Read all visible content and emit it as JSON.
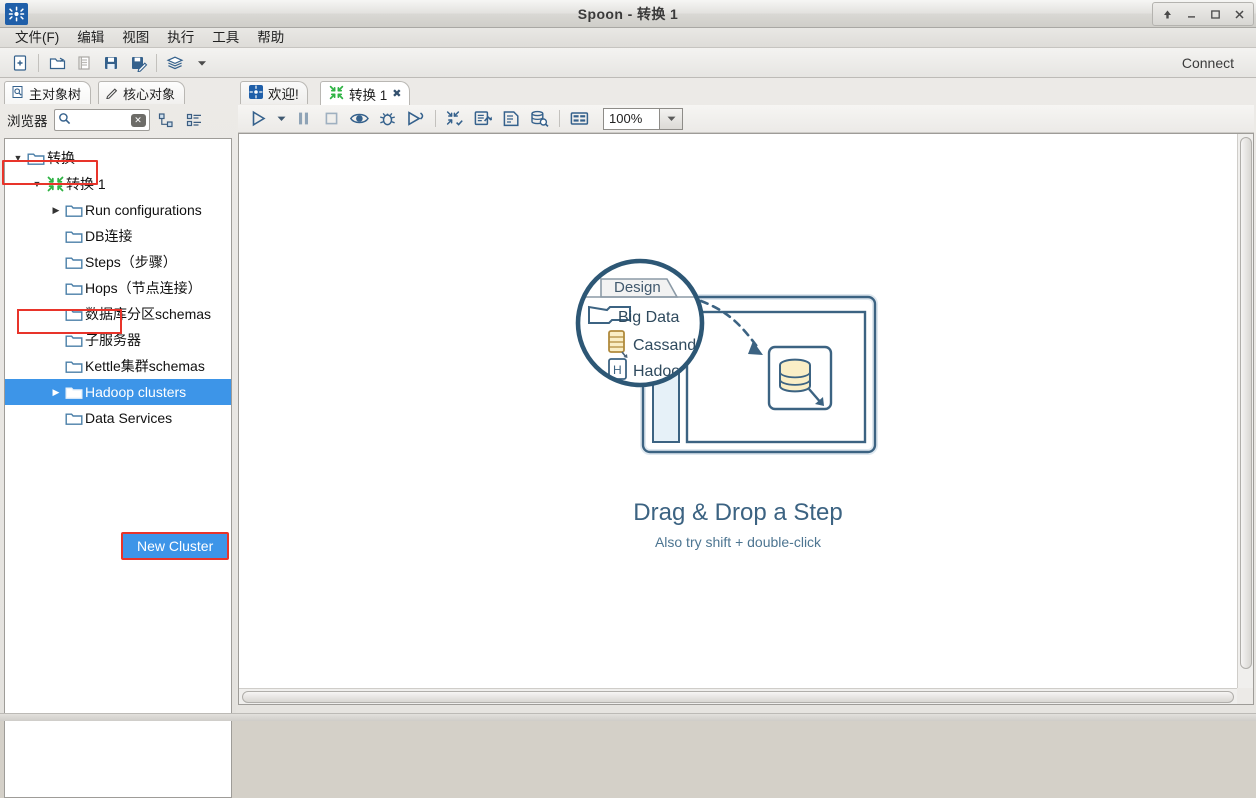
{
  "window": {
    "title": "Spoon - 转换 1",
    "logo_icon": "pentaho-spoon-logo-icon",
    "controls": [
      {
        "name": "restore-up-button",
        "glyph": "⬆"
      },
      {
        "name": "minimize-button",
        "glyph": "–"
      },
      {
        "name": "maximize-button",
        "glyph": "❐"
      },
      {
        "name": "close-button",
        "glyph": "✕"
      }
    ]
  },
  "menubar": {
    "items": [
      {
        "label": "文件(F)",
        "name": "menu-file"
      },
      {
        "label": "编辑",
        "name": "menu-edit"
      },
      {
        "label": "视图",
        "name": "menu-view"
      },
      {
        "label": "执行",
        "name": "menu-run"
      },
      {
        "label": "工具",
        "name": "menu-tools"
      },
      {
        "label": "帮助",
        "name": "menu-help"
      }
    ]
  },
  "toolbar": {
    "connect_label": "Connect",
    "buttons": [
      {
        "name": "new-file-button",
        "icon": "new-file-icon"
      },
      {
        "name": "open-file-button",
        "icon": "open-folder-icon"
      },
      {
        "name": "explorer-panel-button",
        "icon": "panel-list-icon"
      },
      {
        "name": "save-button",
        "icon": "floppy-save-icon"
      },
      {
        "name": "save-as-button",
        "icon": "save-as-pencil-icon"
      },
      {
        "name": "layers-button",
        "icon": "layers-stack-icon"
      },
      {
        "name": "layers-dropdown-button",
        "icon": "chevron-down-icon"
      }
    ]
  },
  "left_panel": {
    "tabs": [
      {
        "label": "主对象树",
        "name": "tab-main-object-tree",
        "icon": "document-search-icon",
        "active": true,
        "highlighted": true
      },
      {
        "label": "核心对象",
        "name": "tab-core-objects",
        "icon": "pencil-icon",
        "active": false,
        "highlighted": false
      }
    ],
    "browser_label": "浏览器",
    "search": {
      "value": "",
      "placeholder": "",
      "icon": "search-icon",
      "clear_icon": "clear-x-icon"
    },
    "tree_tools": [
      {
        "name": "collapse-all-button",
        "icon": "hierarchy-collapse-icon"
      },
      {
        "name": "expand-all-button",
        "icon": "list-expand-icon"
      }
    ],
    "tree": [
      {
        "label": "转换",
        "icon": "folder-icon",
        "twisty": "▼",
        "indent": 0,
        "selected": false
      },
      {
        "label": "转换 1",
        "icon": "transformation-green-icon",
        "twisty": "▼",
        "indent": 1,
        "selected": false,
        "highlighted": true
      },
      {
        "label": "Run configurations",
        "icon": "folder-icon",
        "twisty": "▶",
        "indent": 2,
        "selected": false
      },
      {
        "label": "DB连接",
        "icon": "folder-icon",
        "twisty": "",
        "indent": 2,
        "selected": false
      },
      {
        "label": "Steps（步骤）",
        "icon": "folder-icon",
        "twisty": "",
        "indent": 2,
        "selected": false
      },
      {
        "label": "Hops（节点连接）",
        "icon": "folder-icon",
        "twisty": "",
        "indent": 2,
        "selected": false
      },
      {
        "label": "数据库分区schemas",
        "icon": "folder-icon",
        "twisty": "",
        "indent": 2,
        "selected": false
      },
      {
        "label": "子服务器",
        "icon": "folder-icon",
        "twisty": "",
        "indent": 2,
        "selected": false
      },
      {
        "label": "Kettle集群schemas",
        "icon": "folder-icon",
        "twisty": "",
        "indent": 2,
        "selected": false
      },
      {
        "label": "Hadoop clusters",
        "icon": "folder-icon",
        "twisty": "▶",
        "indent": 2,
        "selected": true
      },
      {
        "label": "Data Services",
        "icon": "folder-icon",
        "twisty": "",
        "indent": 2,
        "selected": false
      }
    ],
    "popup": {
      "label": "New Cluster",
      "name": "new-cluster-popup"
    }
  },
  "editor": {
    "tabs": [
      {
        "label": "欢迎!",
        "name": "tab-welcome",
        "icon": "spoon-blue-icon",
        "active": false,
        "closable": false
      },
      {
        "label": "转换 1",
        "name": "tab-transformation-1",
        "icon": "transformation-green-icon",
        "active": true,
        "closable": true,
        "close_glyph": "✖"
      }
    ],
    "canvas_toolbar": {
      "zoom_value": "100%",
      "buttons": [
        {
          "name": "run-button",
          "icon": "play-triangle-icon"
        },
        {
          "name": "run-options-dropdown",
          "icon": "chevron-down-icon"
        },
        {
          "name": "pause-button",
          "icon": "pause-icon"
        },
        {
          "name": "stop-button",
          "icon": "stop-square-icon"
        },
        {
          "name": "preview-button",
          "icon": "eye-preview-icon"
        },
        {
          "name": "debug-button",
          "icon": "bug-debug-icon"
        },
        {
          "name": "run-step-button",
          "icon": "play-step-icon"
        },
        {
          "name": "verify-button",
          "icon": "transformation-check-icon"
        },
        {
          "name": "impact-analysis-button",
          "icon": "impact-chart-icon"
        },
        {
          "name": "generate-sql-button",
          "icon": "sql-document-icon"
        },
        {
          "name": "explore-database-button",
          "icon": "database-search-icon"
        },
        {
          "name": "show-grid-button",
          "icon": "grid-rows-icon"
        }
      ]
    },
    "hero": {
      "title": "Drag & Drop a Step",
      "subtitle": "Also try shift + double-click",
      "illustration": {
        "name": "drag-drop-illustration",
        "magnifier_tab_label": "Design",
        "magnifier_items": [
          {
            "label": "Big Data",
            "icon": "folder-icon"
          },
          {
            "label": "Cassandra",
            "icon": "cassandra-database-icon"
          },
          {
            "label": "Hadoop",
            "icon": "hadoop-h-icon"
          }
        ],
        "canvas_step_icon": "database-cylinder-icon"
      }
    }
  },
  "colors": {
    "accent_blue": "#3d95e8",
    "highlight_red": "#e8342a",
    "illustration_ink": "#3c6382",
    "tree_green": "#2fb344"
  }
}
